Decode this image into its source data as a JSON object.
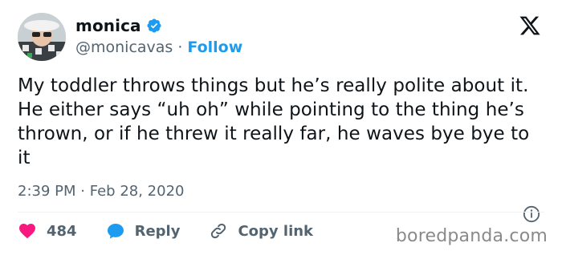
{
  "author": {
    "display_name": "monica",
    "handle": "@monicavas",
    "separator": "·",
    "follow_label": "Follow"
  },
  "tweet": {
    "text": "My toddler throws things but he’s really polite about it. He either says “uh oh” while pointing to the thing he’s thrown, or if he threw it really far, he waves bye bye to it",
    "time": "2:39 PM",
    "date_separator": "·",
    "date": "Feb 28, 2020"
  },
  "actions": {
    "likes_count": "484",
    "reply_label": "Reply",
    "copy_link_label": "Copy link"
  },
  "watermark": "boredpanda.com",
  "icons": {
    "verified": "verified-badge-icon",
    "logo": "x-logo-icon",
    "info": "info-icon",
    "heart": "heart-icon",
    "reply": "reply-icon",
    "link": "link-icon"
  },
  "colors": {
    "accent": "#1d9bf0",
    "heart": "#f91880",
    "text": "#0f1419",
    "muted": "#536471"
  }
}
